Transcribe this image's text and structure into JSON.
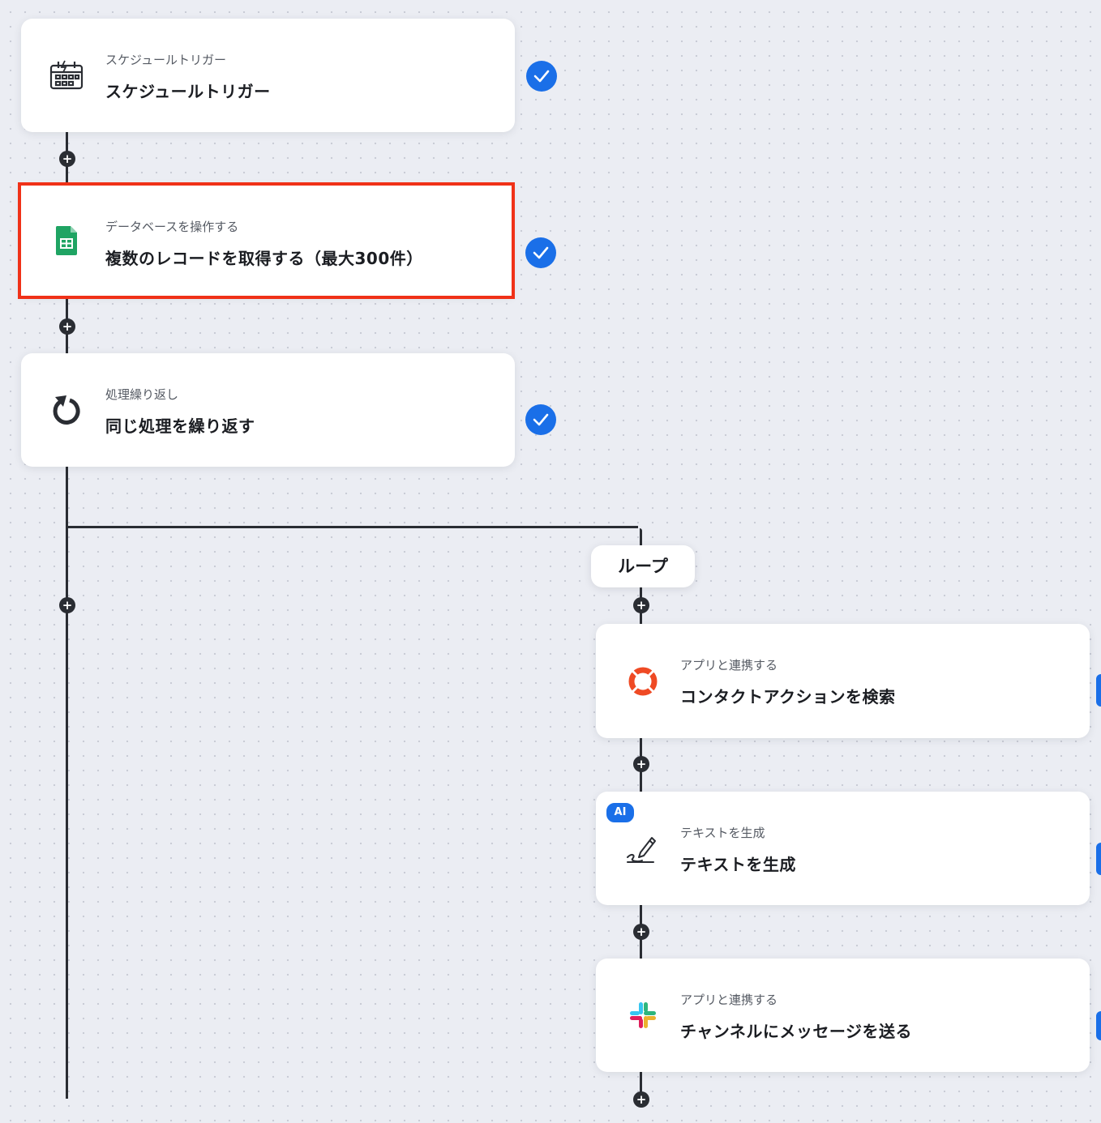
{
  "steps": [
    {
      "subtitle": "スケジュールトリガー",
      "title": "スケジュールトリガー",
      "icon": "schedule-calendar-icon",
      "completed": true
    },
    {
      "subtitle": "データベースを操作する",
      "title": "複数のレコードを取得する（最大300件）",
      "icon": "google-sheets-icon",
      "completed": true,
      "selected": true
    },
    {
      "subtitle": "処理繰り返し",
      "title": "同じ処理を繰り返す",
      "icon": "loop-arrow-icon",
      "completed": true
    }
  ],
  "branch": {
    "label": "ループ",
    "steps": [
      {
        "subtitle": "アプリと連携する",
        "title": "コンタクトアクションを検索",
        "icon": "lifebuoy-icon"
      },
      {
        "subtitle": "テキストを生成",
        "title": "テキストを生成",
        "icon": "pen-write-icon",
        "badge": "AI"
      },
      {
        "subtitle": "アプリと連携する",
        "title": "チャンネルにメッセージを送る",
        "icon": "slack-icon"
      }
    ]
  },
  "colors": {
    "accent": "#1a6fe8",
    "selection": "#f03118",
    "connector": "#2a2d33"
  }
}
